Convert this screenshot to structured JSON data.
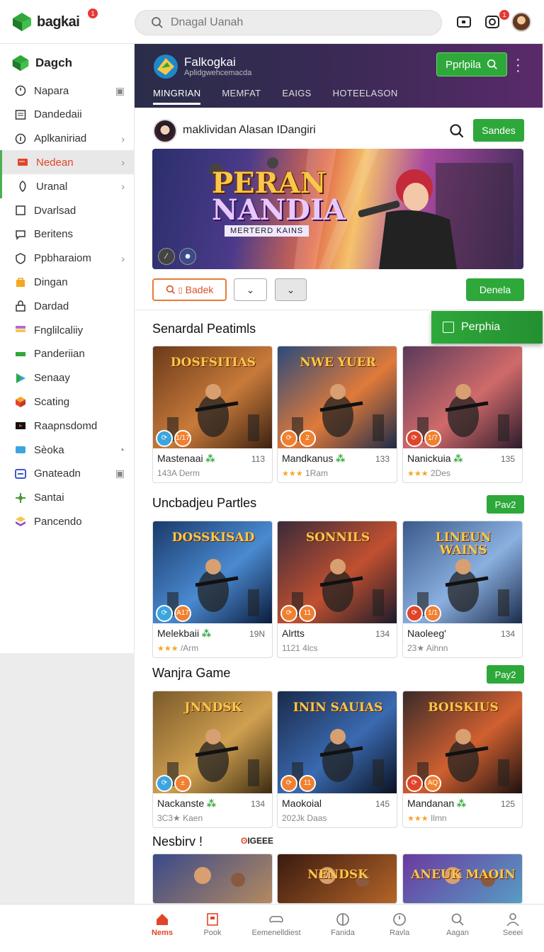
{
  "topbar": {
    "logo_text": "bagkai",
    "logo_badge": "1",
    "search_placeholder": "Dnagal Uanah",
    "notif_count": "1"
  },
  "sidebar": {
    "header": "Dagch",
    "items": [
      {
        "label": "Napara",
        "icon": "clock-icon"
      },
      {
        "label": "Dandedaii",
        "icon": "list-icon"
      },
      {
        "label": "Aplkaniriad",
        "icon": "info-icon"
      },
      {
        "label": "Nedean",
        "icon": "card-icon"
      },
      {
        "label": "Uranal",
        "icon": "leaf-icon"
      },
      {
        "label": "Dvarlsad",
        "icon": "square-icon"
      },
      {
        "label": "Beritens",
        "icon": "chat-icon"
      },
      {
        "label": "Ppbharaiom",
        "icon": "shield-icon"
      },
      {
        "label": "Dingan",
        "icon": "bag-icon"
      },
      {
        "label": "Dardad",
        "icon": "lock-icon"
      },
      {
        "label": "Fnglilcaliiy",
        "icon": "flag-icon"
      },
      {
        "label": "Panderiian",
        "icon": "bars-icon"
      },
      {
        "label": "Senaay",
        "icon": "play-icon"
      },
      {
        "label": "Scating",
        "icon": "cube-icon"
      },
      {
        "label": "Raapnsdomd",
        "icon": "video-icon"
      },
      {
        "label": "Sèoka",
        "icon": "bubble-icon"
      },
      {
        "label": "Gnateadn",
        "icon": "window-icon"
      },
      {
        "label": "Santai",
        "icon": "palm-icon"
      },
      {
        "label": "Pancendo",
        "icon": "stack-icon"
      }
    ]
  },
  "banner": {
    "title": "Falkogkai",
    "subtitle": "Aplidgwehcemacda",
    "button": "Pprlpila",
    "tabs": [
      "MINGRIAN",
      "MEMFAT",
      "EAIGS",
      "HOTEELASON"
    ]
  },
  "profile": {
    "name": "maklividan Alasan IDangiri",
    "button": "Sandes"
  },
  "hero": {
    "title_line1": "PERAN",
    "title_line2": "NANDIA",
    "subtitle": "MERTERD KAINS"
  },
  "filters": {
    "primary": "Badek",
    "action": "Denela"
  },
  "float_button": "Perphia",
  "sections": [
    {
      "title": "Senardal Peatimls",
      "button": "",
      "cards": [
        {
          "img_title": "DOSFSITIAS",
          "badge": "1/17",
          "name": "Mastenaai",
          "num": "113",
          "meta": "143A Derm",
          "rating": "",
          "green": true
        },
        {
          "img_title": "NWE YUER",
          "badge": "2",
          "name": "Mandkanus",
          "num": "133",
          "meta": "1Ram",
          "rating": "★★★",
          "green": true
        },
        {
          "img_title": "",
          "badge": "1/7",
          "name": "Nanickuia",
          "num": "135",
          "meta": "2Des",
          "rating": "★★★",
          "green": true
        }
      ]
    },
    {
      "title": "Uncbadjeu Partles",
      "button": "Pav2",
      "cards": [
        {
          "img_title": "DOSSKISAD",
          "badge": "A17",
          "name": "Melekbaii",
          "num": "19N",
          "meta": "/Arm",
          "rating": "★★★",
          "green": true
        },
        {
          "img_title": "SONNILS",
          "badge": "11",
          "name": "Alrtts",
          "num": "134",
          "meta": "1121 4lcs",
          "rating": "",
          "green": false
        },
        {
          "img_title": "LINEUN WAINS",
          "badge": "1/1",
          "name": "Naoleeg'",
          "num": "134",
          "meta": "23★ Aihnn",
          "rating": "",
          "green": false
        }
      ]
    },
    {
      "title": "Wanjra Game",
      "button": "Pay2",
      "cards": [
        {
          "img_title": "JNNDSK",
          "badge": "±",
          "name": "Nackanste",
          "num": "134",
          "meta": "3C3★ Kaen",
          "rating": "",
          "green": true
        },
        {
          "img_title": "ININ SAUIAS",
          "badge": "11",
          "name": "Maokoial",
          "num": "145",
          "meta": "202Jk Daas",
          "rating": "",
          "green": false
        },
        {
          "img_title": "BOISKIUS",
          "badge": "AQ",
          "name": "Mandanan",
          "num": "125",
          "meta": "Ilmn",
          "rating": "★★★",
          "green": true
        }
      ]
    }
  ],
  "last_section": {
    "title": "Nesbirv !",
    "tag": "IGEEE",
    "cards": [
      "",
      "NENDSK",
      "ANEUK MAOIN"
    ]
  },
  "bottom_nav": [
    {
      "label": "Nems",
      "icon": "home-icon"
    },
    {
      "label": "Pook",
      "icon": "book-icon"
    },
    {
      "label": "Eemenelldiest",
      "icon": "controller-icon"
    },
    {
      "label": "Fanida",
      "icon": "compass-icon"
    },
    {
      "label": "Ravla",
      "icon": "clock-icon"
    },
    {
      "label": "Aagan",
      "icon": "search-icon"
    },
    {
      "label": "Seeei",
      "icon": "user-icon"
    }
  ],
  "colors": {
    "accent_green": "#2ea83a",
    "accent_orange": "#e0452a"
  }
}
